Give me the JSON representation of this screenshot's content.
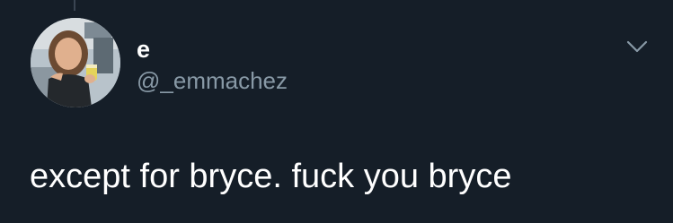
{
  "tweet": {
    "author": {
      "display_name": "e",
      "handle": "@_emmachez",
      "avatar_icon": "profile-photo"
    },
    "menu_icon": "chevron-down-icon",
    "text": "except for bryce. fuck you bryce"
  },
  "colors": {
    "background": "#151e28",
    "primary_text": "#ffffff",
    "secondary_text": "#8899a6",
    "thread_line": "#3a4552"
  }
}
